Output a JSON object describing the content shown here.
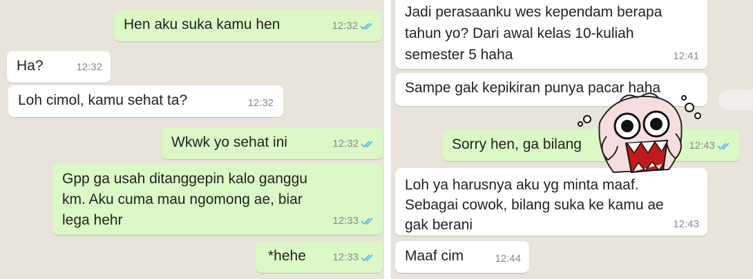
{
  "left": {
    "messages": [
      {
        "text": "Hen aku suka kamu hen",
        "time": "12:32",
        "direction": "out"
      },
      {
        "text": "Ha?",
        "time": "12:32",
        "direction": "in"
      },
      {
        "text": "Loh cimol, kamu sehat ta?",
        "time": "12:32",
        "direction": "in"
      },
      {
        "text": "Wkwk yo sehat ini",
        "time": "12:32",
        "direction": "out"
      },
      {
        "text": "Gpp ga usah ditanggepin kalo ganggu\nkm. Aku cuma mau ngomong ae, biar\nlega hehr",
        "time": "12:33",
        "direction": "out"
      },
      {
        "text": "*hehe",
        "time": "12:33",
        "direction": "out"
      }
    ]
  },
  "right": {
    "messages": [
      {
        "text": "Jadi perasaanku wes kependam berapa\ntahun yo? Dari awal kelas 10-kuliah\nsemester 5 haha",
        "time": "12:41",
        "direction": "in"
      },
      {
        "text": "Sampe gak kepikiran punya pacar haha",
        "time": "",
        "direction": "in"
      },
      {
        "text": "Sorry hen, ga bilang",
        "time": "12:43",
        "direction": "out"
      },
      {
        "text": "Loh ya harusnya aku yg minta maaf.\nSebagai cowok, bilang suka ke kamu ae\ngak berani",
        "time": "12:43",
        "direction": "in"
      },
      {
        "text": "Maaf cim",
        "time": "12:44",
        "direction": "in"
      }
    ]
  },
  "colors": {
    "background": "#e8e4dc",
    "outgoing_bubble": "#dcf8c6",
    "incoming_bubble": "#ffffff",
    "read_ticks": "#4fb6ec"
  },
  "icons": {
    "read_receipt": "double-check-icon",
    "sticker": "shocked-face-sticker"
  }
}
